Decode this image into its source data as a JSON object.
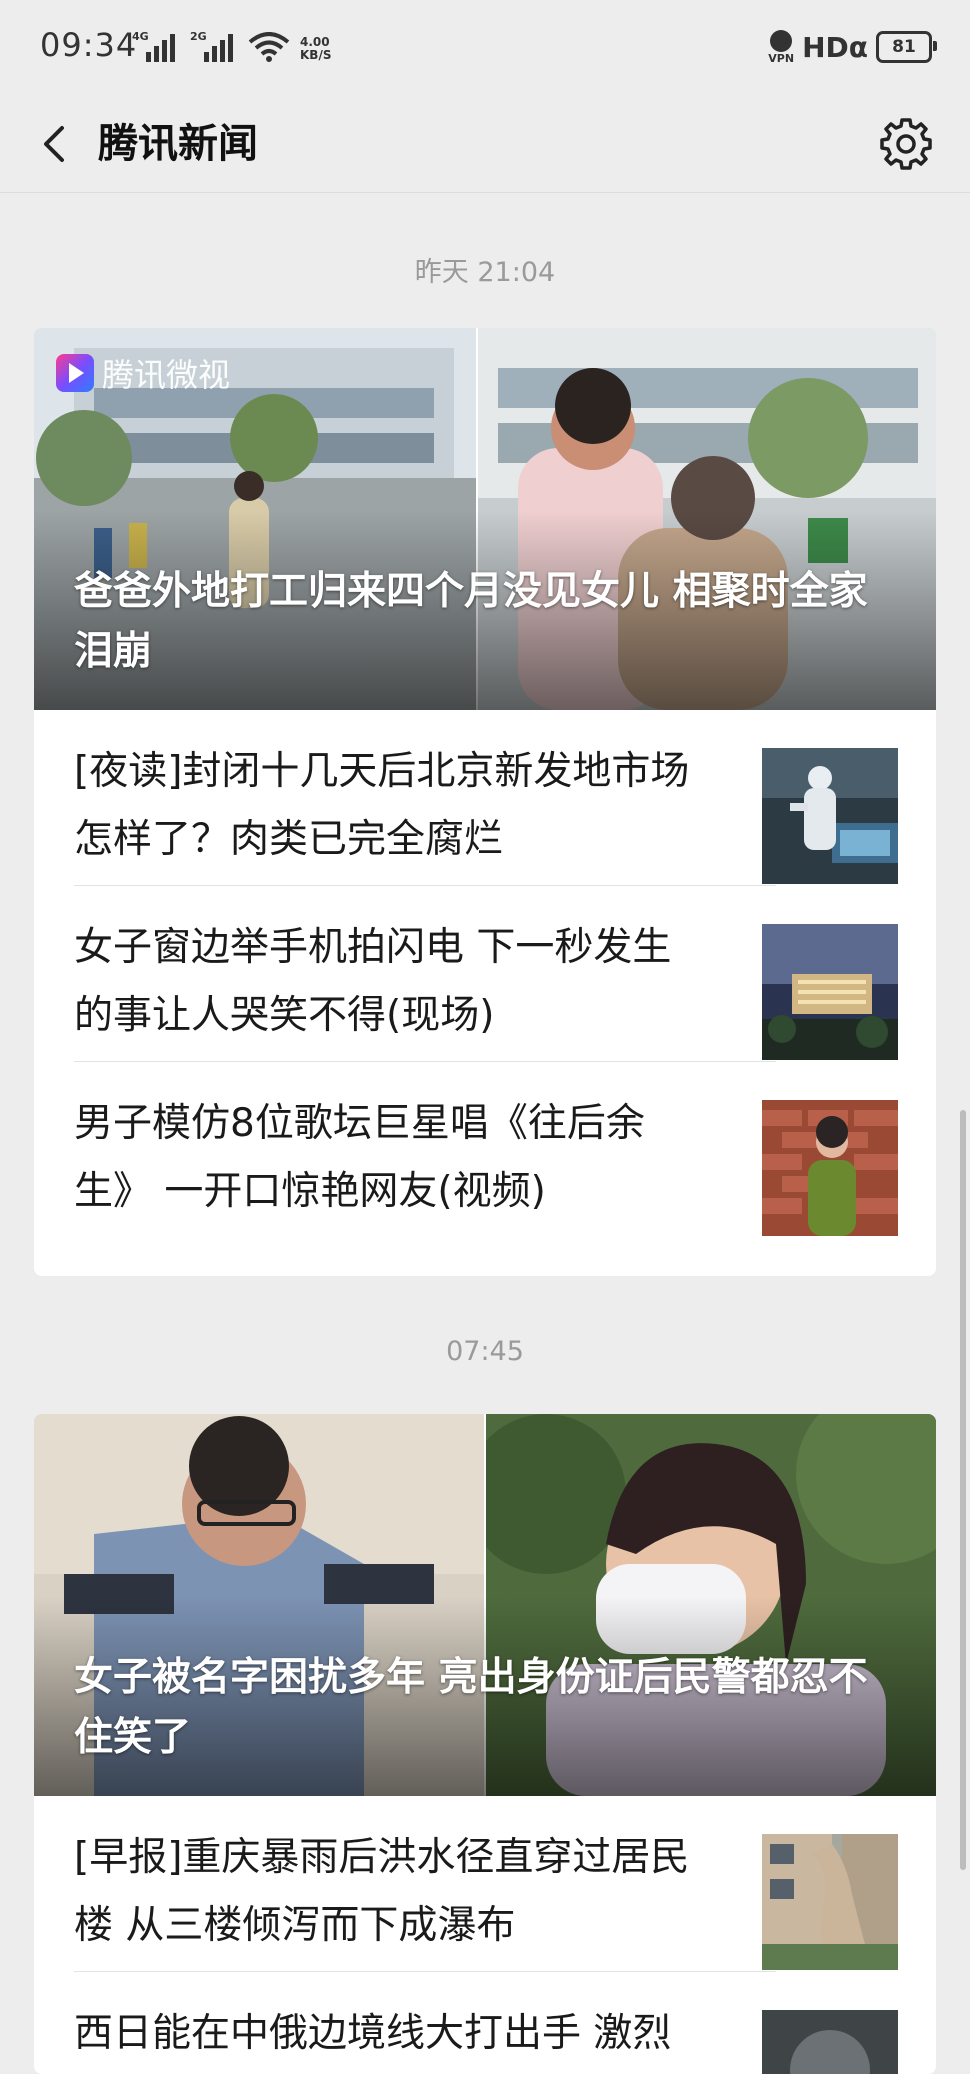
{
  "status_bar": {
    "time": "09:34",
    "signal1_label": "4G",
    "signal2_label": "2G",
    "net_speed_value": "4.00",
    "net_speed_unit": "KB/S",
    "vpn_label": "VPN",
    "hd_label": "HDα",
    "battery": "81"
  },
  "header": {
    "back_icon": "chevron-left-icon",
    "title": "腾讯新闻",
    "settings_icon": "gear-icon"
  },
  "groups": [
    {
      "time": "昨天 21:04",
      "hero": {
        "brand": "腾讯微视",
        "title": "爸爸外地打工归来四个月没见女儿 相聚时全家泪崩"
      },
      "items": [
        {
          "title": "[夜读]封闭十几天后北京新发地市场怎样了？肉类已完全腐烂"
        },
        {
          "title": "女子窗边举手机拍闪电 下一秒发生的事让人哭笑不得(现场)"
        },
        {
          "title": "男子模仿8位歌坛巨星唱《往后余生》 一开口惊艳网友(视频)"
        }
      ]
    },
    {
      "time": "07:45",
      "hero": {
        "title": "女子被名字困扰多年 亮出身份证后民警都忍不住笑了"
      },
      "items": [
        {
          "title": "[早报]重庆暴雨后洪水径直穿过居民楼 从三楼倾泻而下成瀑布"
        },
        {
          "title": "西日能在中俄边境线大打出手 激烈"
        }
      ]
    }
  ],
  "colors": {
    "background": "#ededed",
    "card": "#ffffff",
    "time_label": "#9a9a9a"
  }
}
